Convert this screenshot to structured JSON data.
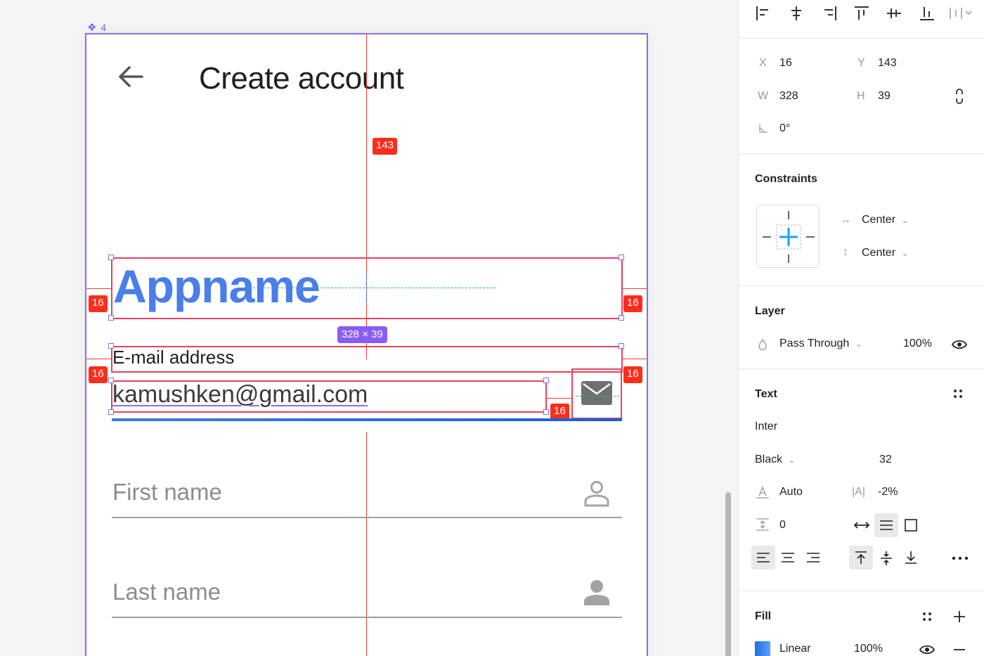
{
  "canvas": {
    "frame_label": "4",
    "screen": {
      "title": "Create account",
      "appname": "Appname",
      "email_label": "E-mail address",
      "email_value": "kamushken@gmail.com",
      "first_name_placeholder": "First name",
      "last_name_placeholder": "Last name"
    },
    "measurements": {
      "top_distance": "143",
      "left_appname": "16",
      "right_appname": "16",
      "left_email": "16",
      "right_email": "16",
      "gap_icon": "16",
      "size": "328 × 39"
    }
  },
  "inspector": {
    "position": {
      "x_label": "X",
      "x_value": "16",
      "y_label": "Y",
      "y_value": "143",
      "w_label": "W",
      "w_value": "328",
      "h_label": "H",
      "h_value": "39",
      "rotation_value": "0°"
    },
    "constraints": {
      "title": "Constraints",
      "horizontal": "Center",
      "vertical": "Center"
    },
    "layer": {
      "title": "Layer",
      "blend": "Pass Through",
      "opacity": "100%"
    },
    "text": {
      "title": "Text",
      "font": "Inter",
      "weight": "Black",
      "size": "32",
      "line_height": "Auto",
      "letter_spacing_label": "|A|",
      "letter_spacing": "-2%",
      "paragraph_spacing": "0"
    },
    "fill": {
      "title": "Fill",
      "type": "Linear",
      "opacity": "100%"
    }
  },
  "colors": {
    "accent": "#7b61ff",
    "measure": "#ff2d1a",
    "brand_blue": "#4a7ee8",
    "constraint_blue": "#18a0fb"
  }
}
